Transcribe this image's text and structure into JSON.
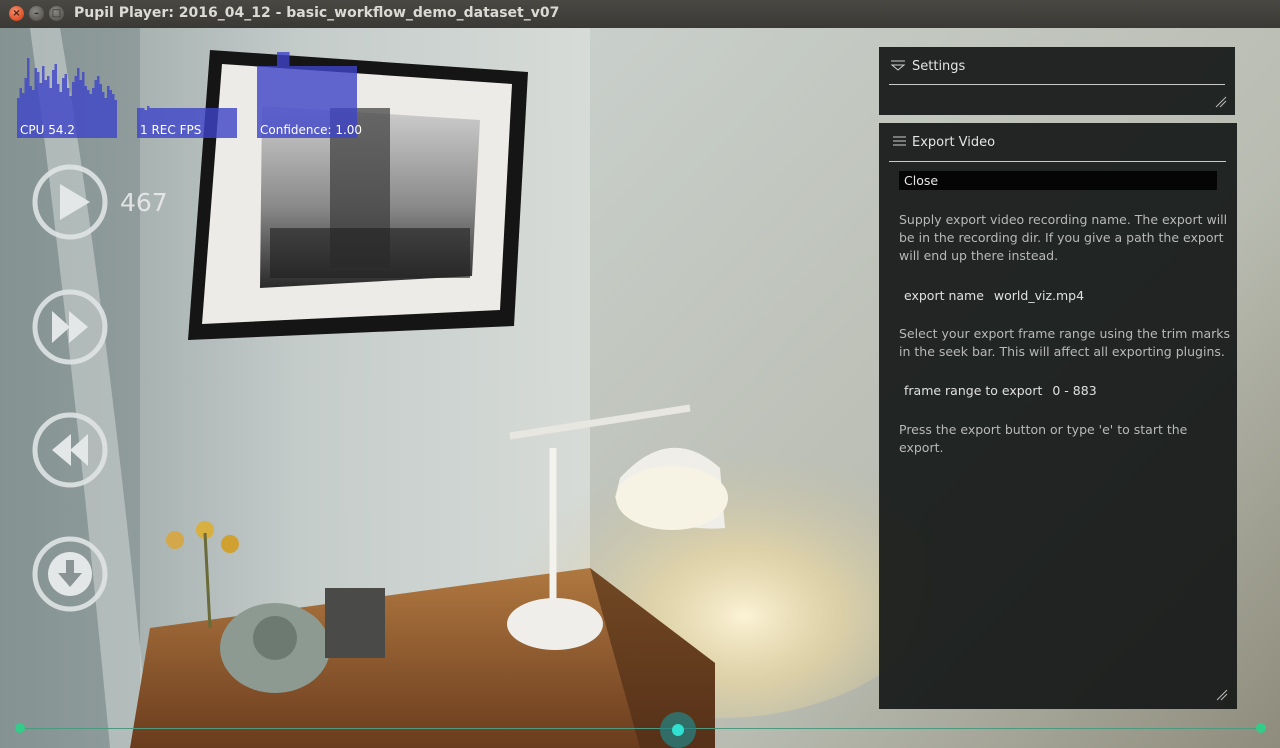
{
  "window": {
    "title": "Pupil Player: 2016_04_12 - basic_workflow_demo_dataset_v07",
    "controls": {
      "close_glyph": "×",
      "minimize_glyph": "–",
      "maximize_glyph": "□"
    }
  },
  "graphs": {
    "cpu_label": "CPU 54.2",
    "fps_label": "1 REC FPS",
    "confidence_label": "Confidence: 1.00",
    "bar_color": "#3d44c8"
  },
  "playback": {
    "frame_number": "467",
    "play_icon": "play-icon",
    "forward_icon": "fast-forward-icon",
    "backward_icon": "rewind-icon",
    "export_icon": "download-icon"
  },
  "seek_bar": {
    "position_fraction": 0.53,
    "accent": "#33cc88"
  },
  "settings_panel": {
    "title": "Settings",
    "menu_icon": "collapse-menu-icon"
  },
  "export_panel": {
    "title": "Export Video",
    "menu_icon": "menu-icon",
    "close_label": "Close",
    "info_name": "Supply export video recording name. The export will be in the recording dir. If you give a path the export will end up there instead.",
    "export_name_label": "export name",
    "export_name_value": "world_viz.mp4",
    "info_range": "Select your export frame range using the trim marks in the seek bar. This will affect all exporting plugins.",
    "frame_range_label": "frame range to export",
    "frame_range_value": "0 - 883",
    "info_export": "Press the export button or type 'e' to start the export."
  }
}
